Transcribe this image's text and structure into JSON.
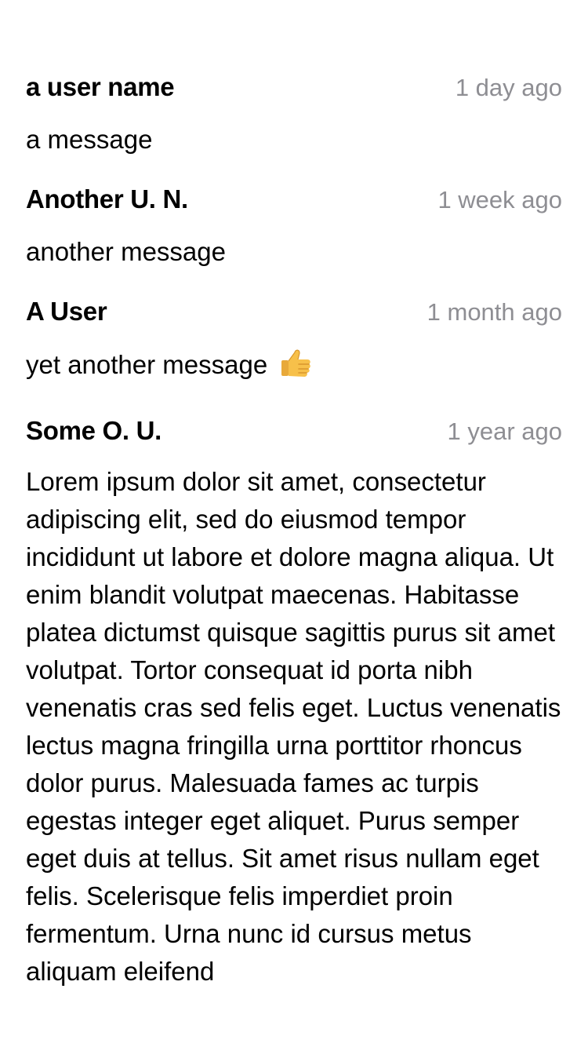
{
  "comments": [
    {
      "user": "a user name",
      "time": "1 day ago",
      "message": "a message"
    },
    {
      "user": "Another U. N.",
      "time": "1 week ago",
      "message": "another message"
    },
    {
      "user": "A User",
      "time": "1 month ago",
      "message": "yet another message",
      "emoji_icon": "thumbs-up-icon"
    },
    {
      "user": "Some O. U.",
      "time": "1 year ago",
      "message": "Lorem ipsum dolor sit amet, consectetur adipiscing elit, sed do eiusmod tempor incididunt ut labore et dolore magna aliqua. Ut enim blandit volutpat maecenas. Habitasse platea dictumst quisque sagittis purus sit amet volutpat. Tortor consequat id porta nibh venenatis cras sed felis eget. Luctus venenatis lectus magna fringilla urna porttitor rhoncus dolor purus. Malesuada fames ac turpis egestas integer eget aliquet. Purus semper eget duis at tellus. Sit amet risus nullam eget felis. Scelerisque felis imperdiet proin fermentum. Urna nunc id cursus metus aliquam eleifend"
    }
  ],
  "colors": {
    "text": "#000000",
    "timestamp": "#8e8e93",
    "background": "#ffffff"
  }
}
